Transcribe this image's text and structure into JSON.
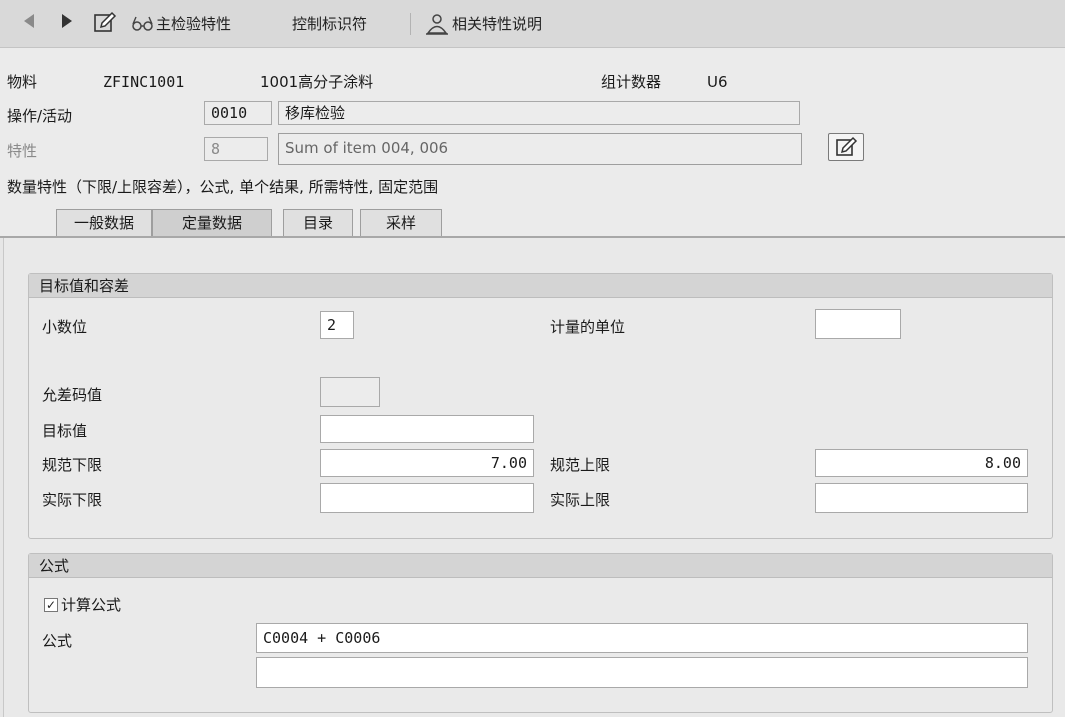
{
  "toolbar": {
    "main_char_label": "主检验特性",
    "control_indicator_label": "控制标识符",
    "related_char_desc_label": "相关特性说明"
  },
  "header": {
    "material_label": "物料",
    "material_value": "ZFINC1001",
    "material_desc": "1001高分子涂料",
    "group_counter_label": "组计数器",
    "group_counter_value": "U6",
    "operation_label": "操作/活动",
    "operation_value": "0010",
    "operation_desc": "移库检验",
    "characteristic_label": "特性",
    "characteristic_value": "8",
    "characteristic_desc": "Sum of item  004, 006",
    "char_type_text": "数量特性（下限/上限容差），公式, 单个结果, 所需特性, 固定范围"
  },
  "tabs": [
    {
      "label": "一般数据"
    },
    {
      "label": "定量数据"
    },
    {
      "label": "目录"
    },
    {
      "label": "采样"
    }
  ],
  "target_group": {
    "title": "目标值和容差",
    "decimal_places_label": "小数位",
    "decimal_places_value": "2",
    "unit_label": "计量的单位",
    "unit_value": "",
    "tolerance_key_label": "允差码值",
    "tolerance_key_value": "",
    "target_value_label": "目标值",
    "target_value_value": "",
    "lower_spec_label": "规范下限",
    "lower_spec_value": "7.00",
    "upper_spec_label": "规范上限",
    "upper_spec_value": "8.00",
    "actual_lower_label": "实际下限",
    "actual_lower_value": "",
    "actual_upper_label": "实际上限",
    "actual_upper_value": ""
  },
  "formula_group": {
    "title": "公式",
    "calc_formula_label": "计算公式",
    "calc_formula_checked": true,
    "formula_label": "公式",
    "formula_line1": "C0004 + C0006",
    "formula_line2": ""
  },
  "icons": [
    "back-arrow-icon",
    "forward-arrow-icon",
    "edit-icon",
    "glasses-icon",
    "people-icon",
    "edit-icon"
  ]
}
